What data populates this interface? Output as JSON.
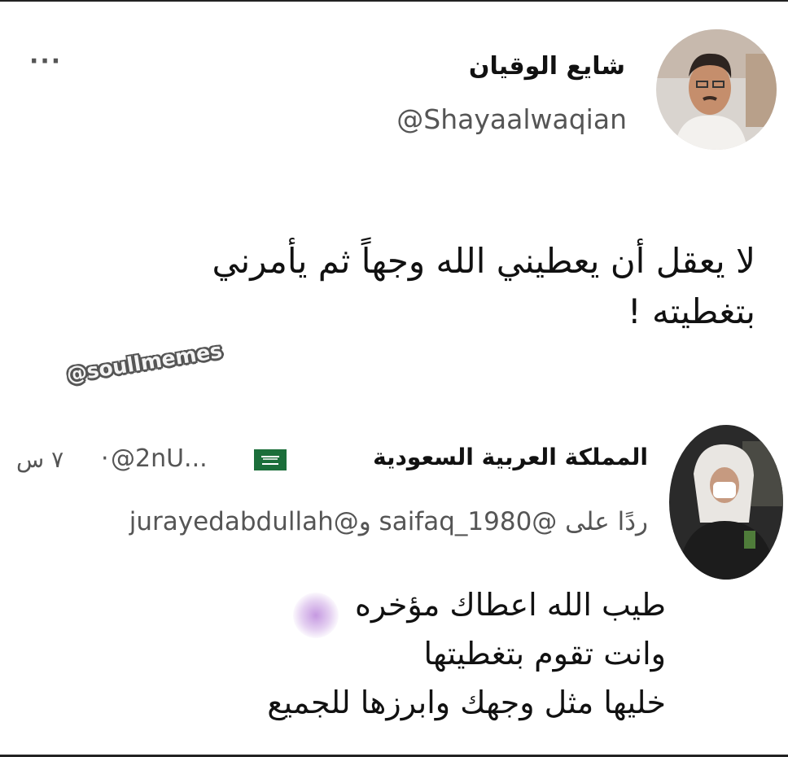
{
  "tweet": {
    "author_name": "شايع الوقيان",
    "author_handle": "@Shayaalwaqian",
    "more_icon": "more-horizontal-icon",
    "text_line1": "لا يعقل أن يعطيني الله وجهاً ثم يأمرني",
    "text_line2": "بتغطيته !"
  },
  "watermark": "@soullmemes",
  "reply": {
    "author_name": "المملكة العربية السعودية",
    "flag_icon": "saudi-flag-icon",
    "handle": "@2nU...",
    "separator": "·",
    "time": "٧ س",
    "replying_prefix": "ردًا على",
    "replying_to": "@saifaq_1980 و@jurayedabdullah",
    "text_line1": "طيب الله اعطاك مؤخره",
    "text_line2": "وانت تقوم بتغطيتها",
    "text_line3": "خليها مثل وجهك وابرزها للجميع"
  },
  "colors": {
    "text": "#111111",
    "muted": "#555555",
    "flag_green": "#1b6e3a",
    "background": "#ffffff"
  }
}
